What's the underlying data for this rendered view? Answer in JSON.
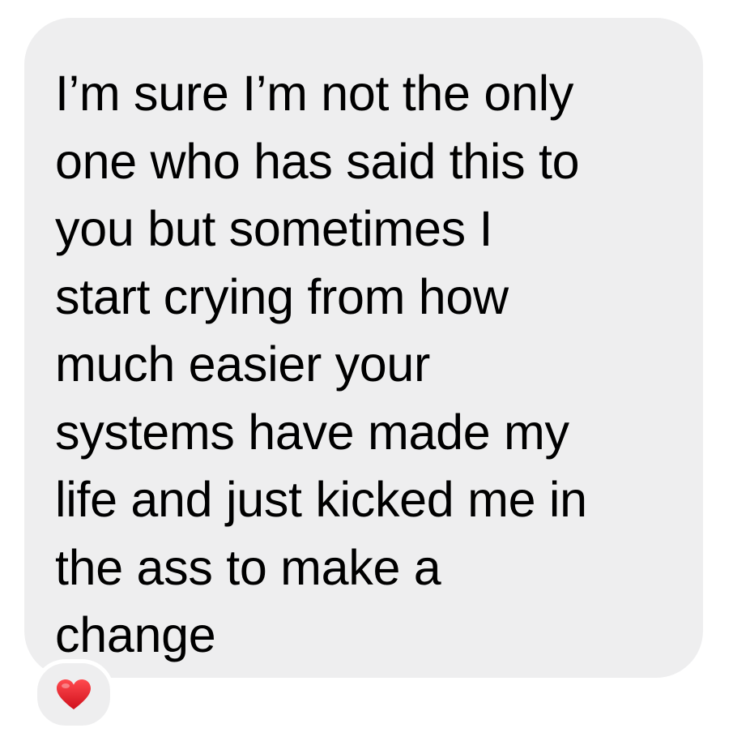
{
  "message": {
    "lines": [
      "I’m sure I’m not the only",
      "one who has said this to",
      "you but sometimes I",
      "start crying from how",
      "much easier your",
      "systems have made my",
      "life and just kicked me in",
      "the ass to make a",
      "change"
    ]
  },
  "reaction": {
    "icon": "red-heart-icon",
    "color": "#e8202a"
  },
  "colors": {
    "bubble": "#eeeeef",
    "text": "#000000",
    "background": "#ffffff"
  }
}
